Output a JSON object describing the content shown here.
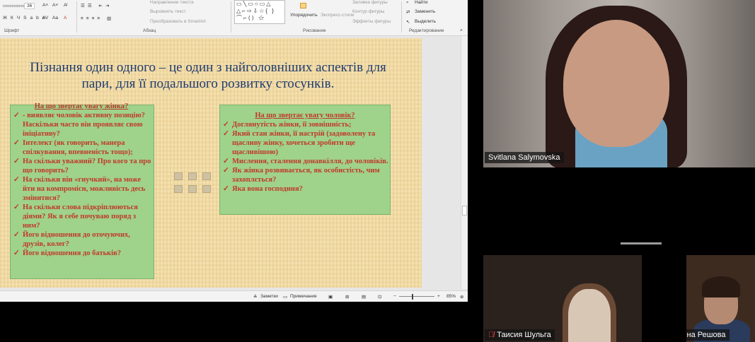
{
  "ribbon": {
    "groups": {
      "font": "Шрифт",
      "paragraph": "Абзац",
      "drawing": "Рисование",
      "editing": "Редактирование"
    },
    "font_size": "36",
    "text_direction": "Направление текста",
    "align_text": "Выровнять текст",
    "convert_smartart": "Преобразовать в SmartArt",
    "arrange": "Упорядочить",
    "quick_styles": "Экспресс-стили",
    "shape_fill": "Заливка фигуры",
    "shape_outline": "Контур фигуры",
    "shape_effects": "Эффекты фигуры",
    "find": "Найти",
    "replace": "Заменить",
    "select": "Выделить"
  },
  "slide": {
    "title": "Пізнання один одного – це один з найголовніших аспектів для пари, для її подальшого розвитку стосунків.",
    "left_box": {
      "heading": "На що звертає увагу жінка?",
      "items": [
        "- виявляє чоловік активну позицію? Наскільки часто він проявляє свою ініціативу?",
        "Інтелект (як говорить, манера спілкування, впевненість тощо);",
        " На скільки уважний? Про кого та про що говорить?",
        "На скільки він «гнучкий», на може йти на компроміси, можливість десь змінитися?",
        "На скільки слова підкріплюються діями? Як я себе почуваю поряд з ним?",
        "Його відношення до оточуючих, друзів, колег?",
        "Його відношення до батьків?"
      ]
    },
    "right_box": {
      "heading": "На що звертає увагу чоловік?",
      "items": [
        "Доглянутість жінки, її зовнішність;",
        "Який стан жінки, її настрій (задоволену та щасливу жінку, хочеться зробити ще щасливішою)",
        "Мислення, сталення донавкілля, до чоловіків.",
        "Як жінка розвивається, як особистість, чим захоплється?",
        "Яка вона господиня?"
      ]
    }
  },
  "statusbar": {
    "notes": "Заметки",
    "comments": "Примечания",
    "zoom": "85%"
  },
  "participants": {
    "main": "Svitlana Salymovska",
    "tile1": "Таисия Шульга",
    "tile2": "Валентина Решова"
  },
  "colors": {
    "slide_title": "#1f3b70",
    "box_fill": "#9fd28a",
    "box_text": "#c0392b"
  }
}
